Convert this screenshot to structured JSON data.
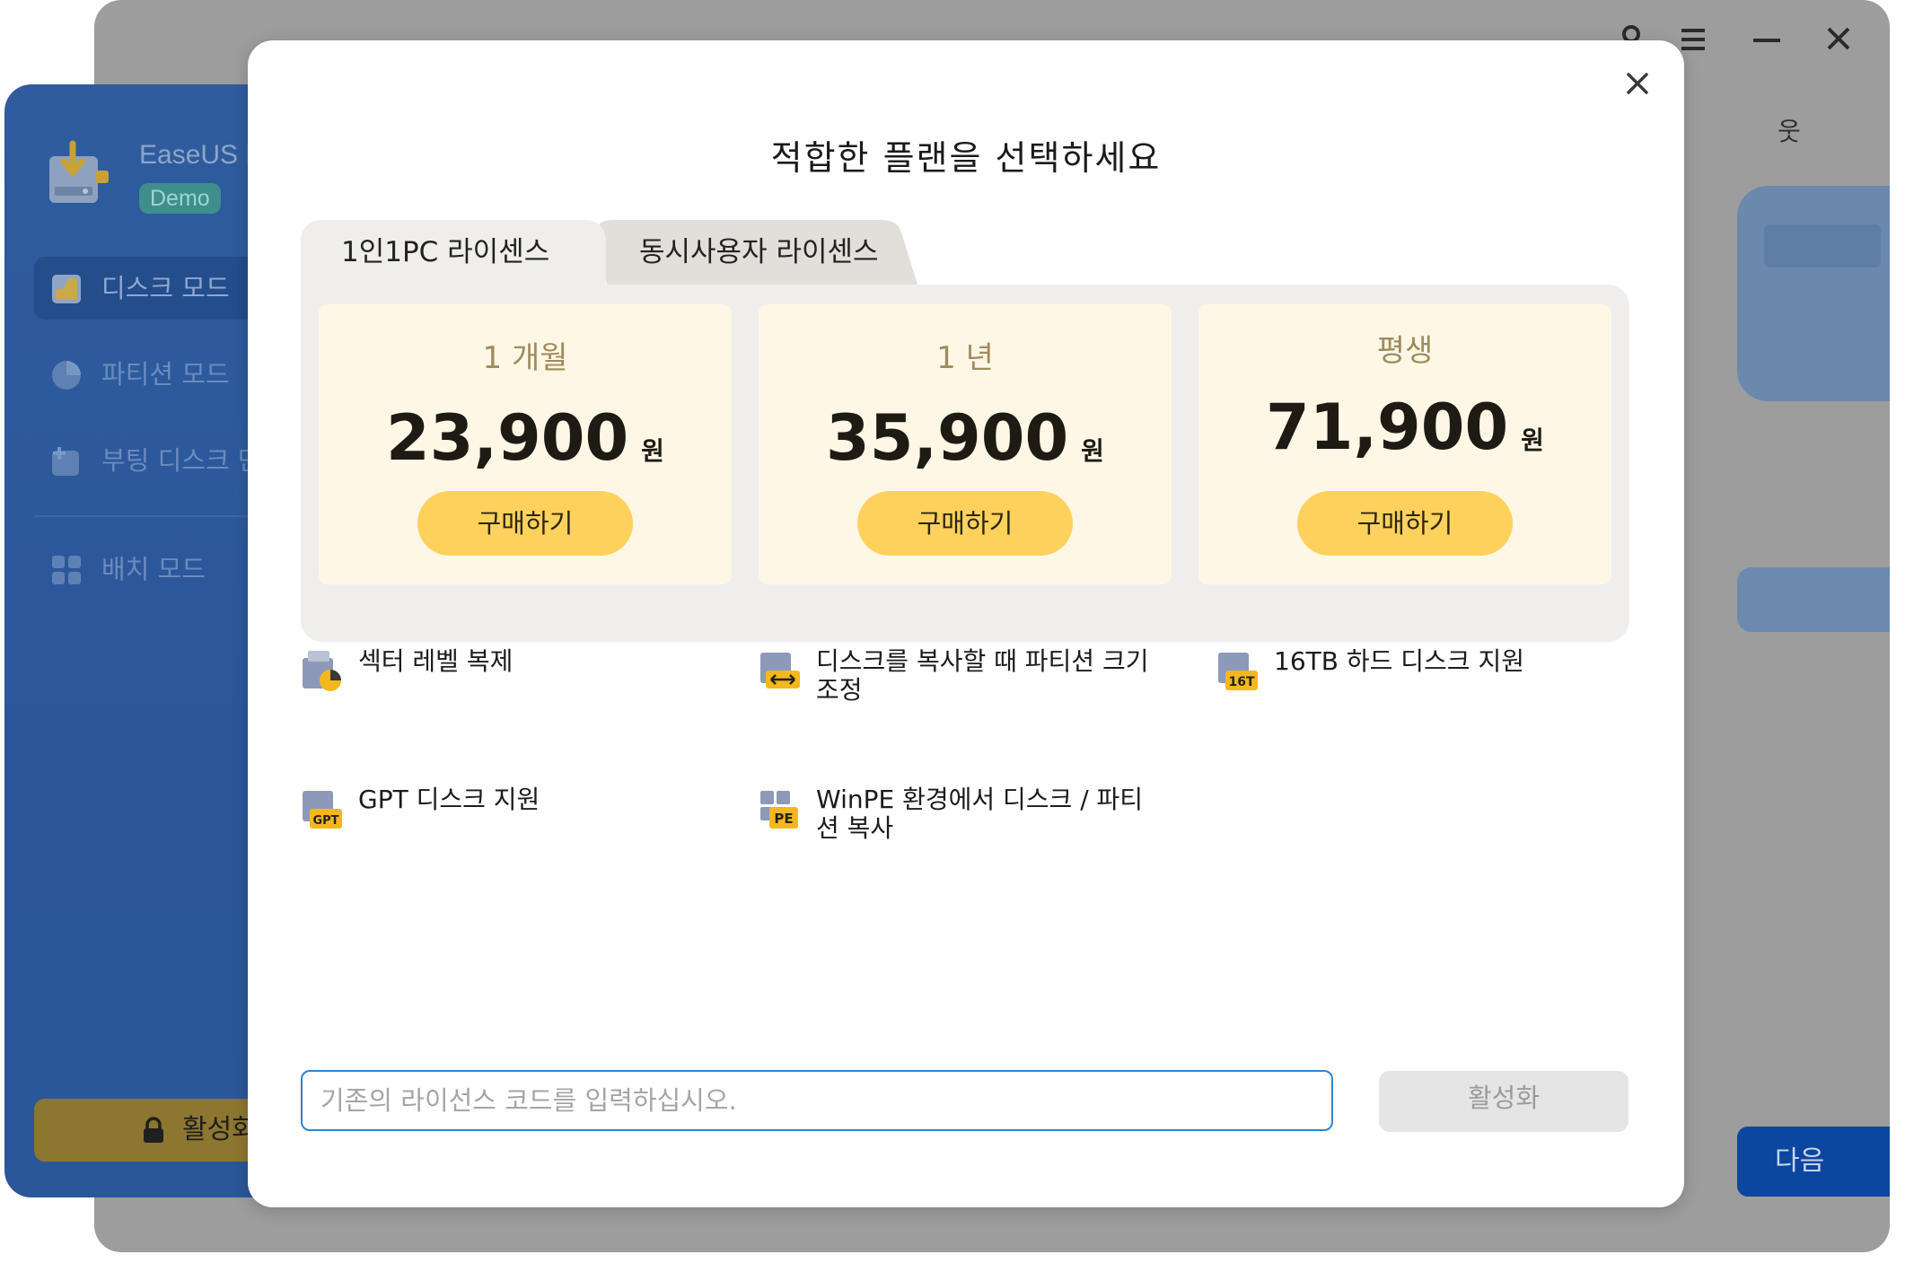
{
  "main_window": {
    "partial_text": "웃",
    "next_button_label": "다음"
  },
  "sidebar": {
    "app_name": "EaseUS D",
    "badge": "Demo",
    "items": [
      {
        "label": "디스크 모드",
        "icon": "disk-mode-icon",
        "active": true
      },
      {
        "label": "파티션 모드",
        "icon": "partition-mode-icon",
        "active": false
      },
      {
        "label": "부팅 디스크 만",
        "icon": "boot-disk-icon",
        "active": false
      },
      {
        "label": "배치 모드",
        "icon": "batch-mode-icon",
        "active": false
      }
    ],
    "activate_label": "활성화"
  },
  "modal": {
    "title": "적합한 플랜을 선택하세요",
    "tabs": [
      {
        "label": "1인1PC 라이센스",
        "active": true
      },
      {
        "label": "동시사용자 라이센스",
        "active": false
      }
    ],
    "plans": [
      {
        "period": "1 개월",
        "price": "23,900",
        "currency": "원",
        "buy_label": "구매하기"
      },
      {
        "period": "1 년",
        "price": "35,900",
        "currency": "원",
        "buy_label": "구매하기"
      },
      {
        "period": "평생",
        "price": "71,900",
        "currency": "원",
        "buy_label": "구매하기"
      }
    ],
    "features": [
      {
        "text": "섹터 레벨 복제",
        "icon": "sector-clone-icon"
      },
      {
        "text": "디스크를 복사할 때 파티션 크기 조정",
        "icon": "resize-partition-icon"
      },
      {
        "text": "16TB 하드 디스크 지원",
        "icon": "16tb-disk-icon",
        "icon_text": "16T"
      },
      {
        "text": "GPT 디스크 지원",
        "icon": "gpt-disk-icon",
        "icon_text": "GPT"
      },
      {
        "text": "WinPE 환경에서 디스크 / 파티션 복사",
        "icon": "winpe-icon",
        "icon_text": "PE"
      }
    ],
    "license_input": {
      "value": "",
      "placeholder": "기존의 라이선스 코드를 입력하십시오."
    },
    "activate_label": "활성화"
  },
  "colors": {
    "accent_blue": "#2f84d2",
    "buy_button": "#fed15c",
    "plan_card": "#fef7e6",
    "plan_panel": "#efeeec",
    "sidebar_blue": "#2b579a"
  }
}
